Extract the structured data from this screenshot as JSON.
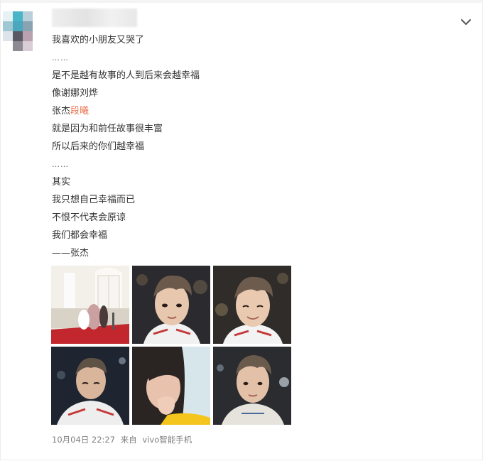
{
  "post": {
    "username_hidden": true,
    "lines": [
      "我喜欢的小朋友又哭了",
      "……",
      "是不是越有故事的人到后来会越幸福",
      "像谢娜刘烨",
      "",
      "就是因为和前任故事很丰富",
      "所以后来的你们越幸福",
      "……",
      "其实",
      "我只想自己幸福而已",
      "不恨不代表会原谅",
      "我们都会幸福",
      "——张杰"
    ],
    "mention_prefix": "张杰",
    "mention_link": "段曦",
    "timestamp": "10月04日 22:27",
    "source_prefix": "来自",
    "source_device": "vivo智能手机"
  },
  "images": [
    {
      "name": "photo-wedding-scene"
    },
    {
      "name": "photo-man-closeup-1"
    },
    {
      "name": "photo-man-closeup-2"
    },
    {
      "name": "photo-man-stage"
    },
    {
      "name": "photo-woman-crying"
    },
    {
      "name": "photo-man-closeup-3"
    }
  ],
  "colors": {
    "link": "#eb7350",
    "text": "#333333",
    "meta": "#808080"
  },
  "icons": {
    "menu": "chevron-down-icon"
  }
}
